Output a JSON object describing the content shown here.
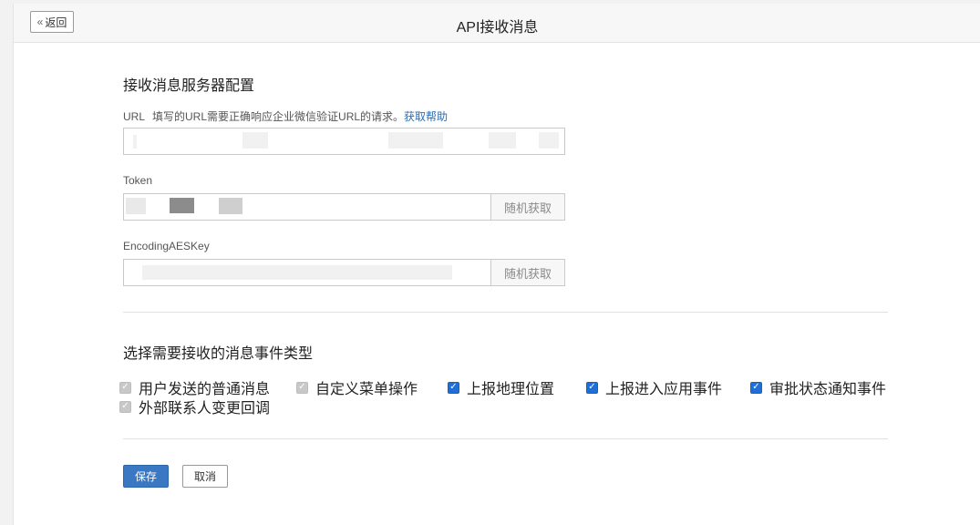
{
  "header": {
    "back_label": "返回",
    "title": "API接收消息"
  },
  "server_config": {
    "title": "接收消息服务器配置",
    "url": {
      "label": "URL",
      "hint": "填写的URL需要正确响应企业微信验证URL的请求。",
      "help": "获取帮助",
      "value_redacted": true
    },
    "token": {
      "label": "Token",
      "random_label": "随机获取",
      "value_redacted": true
    },
    "aes_key": {
      "label": "EncodingAESKey",
      "random_label": "随机获取",
      "value_redacted": true
    }
  },
  "events": {
    "title": "选择需要接收的消息事件类型",
    "items": [
      {
        "label": "用户发送的普通消息",
        "checked": true,
        "disabled": true
      },
      {
        "label": "自定义菜单操作",
        "checked": true,
        "disabled": true
      },
      {
        "label": "上报地理位置",
        "checked": true,
        "disabled": false
      },
      {
        "label": "上报进入应用事件",
        "checked": true,
        "disabled": false
      },
      {
        "label": "审批状态通知事件",
        "checked": true,
        "disabled": false
      },
      {
        "label": "外部联系人变更回调",
        "checked": true,
        "disabled": true
      }
    ]
  },
  "actions": {
    "save_label": "保存",
    "cancel_label": "取消"
  },
  "colors": {
    "accent": "#1f6fd8",
    "save_button": "#3a78c3",
    "link": "#2a6db0"
  }
}
